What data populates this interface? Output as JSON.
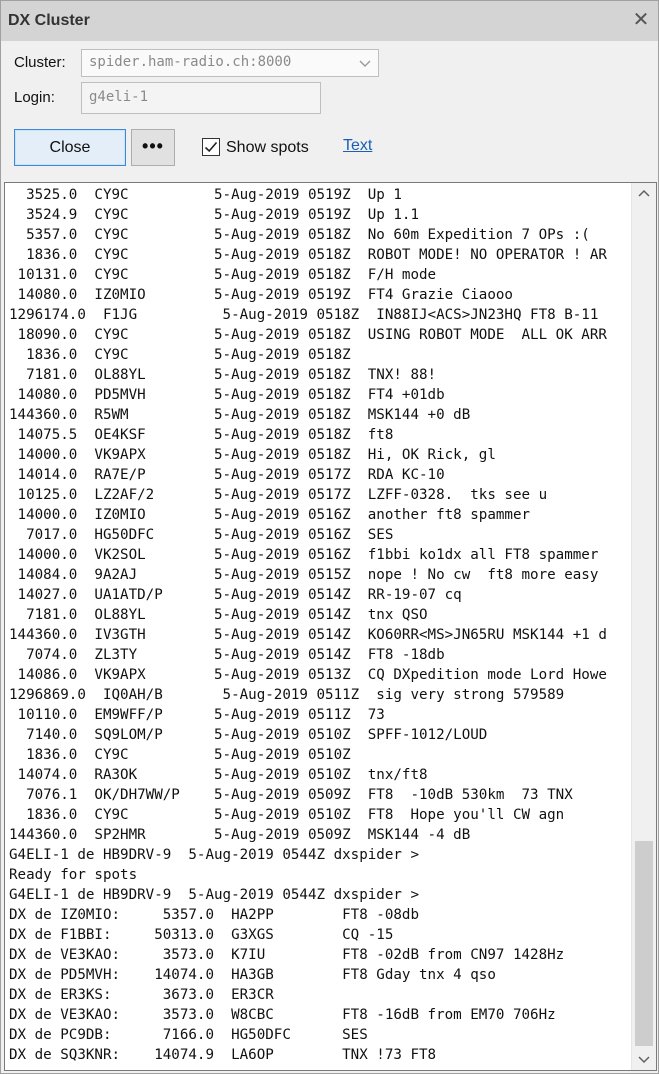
{
  "window": {
    "title": "DX Cluster"
  },
  "form": {
    "cluster_label": "Cluster:",
    "cluster_value": "spider.ham-radio.ch:8000",
    "login_label": "Login:",
    "login_value": "g4eli-1"
  },
  "toolbar": {
    "close_label": "Close",
    "more_label": "•••",
    "show_spots_label": "Show spots",
    "show_spots_checked": true,
    "text_link": "Text"
  },
  "console": {
    "lines": [
      "  3525.0  CY9C          5-Aug-2019 0519Z  Up 1",
      "  3524.9  CY9C          5-Aug-2019 0519Z  Up 1.1",
      "  5357.0  CY9C          5-Aug-2019 0518Z  No 60m Expedition 7 OPs :(",
      "  1836.0  CY9C          5-Aug-2019 0518Z  ROBOT MODE! NO OPERATOR ! AR",
      " 10131.0  CY9C          5-Aug-2019 0518Z  F/H mode",
      " 14080.0  IZ0MIO        5-Aug-2019 0519Z  FT4 Grazie Ciaooo",
      "1296174.0  F1JG          5-Aug-2019 0518Z  IN88IJ<ACS>JN23HQ FT8 B-11",
      " 18090.0  CY9C          5-Aug-2019 0518Z  USING ROBOT MODE  ALL OK ARR",
      "  1836.0  CY9C          5-Aug-2019 0518Z",
      "  7181.0  OL88YL        5-Aug-2019 0518Z  TNX! 88!",
      " 14080.0  PD5MVH        5-Aug-2019 0518Z  FT4 +01db",
      "144360.0  R5WM          5-Aug-2019 0518Z  MSK144 +0 dB",
      " 14075.5  OE4KSF        5-Aug-2019 0518Z  ft8",
      " 14000.0  VK9APX        5-Aug-2019 0518Z  Hi, OK Rick, gl",
      " 14014.0  RA7E/P        5-Aug-2019 0517Z  RDA KC-10",
      " 10125.0  LZ2AF/2       5-Aug-2019 0517Z  LZFF-0328.  tks see u",
      " 14000.0  IZ0MIO        5-Aug-2019 0516Z  another ft8 spammer",
      "  7017.0  HG50DFC       5-Aug-2019 0516Z  SES",
      " 14000.0  VK2SOL        5-Aug-2019 0516Z  f1bbi ko1dx all FT8 spammer",
      " 14084.0  9A2AJ         5-Aug-2019 0515Z  nope ! No cw  ft8 more easy",
      " 14027.0  UA1ATD/P      5-Aug-2019 0514Z  RR-19-07 cq",
      "  7181.0  OL88YL        5-Aug-2019 0514Z  tnx QSO",
      "144360.0  IV3GTH        5-Aug-2019 0514Z  KO60RR<MS>JN65RU MSK144 +1 d",
      "  7074.0  ZL3TY         5-Aug-2019 0514Z  FT8 -18db",
      " 14086.0  VK9APX        5-Aug-2019 0513Z  CQ DXpedition mode Lord Howe",
      "1296869.0  IQ0AH/B       5-Aug-2019 0511Z  sig very strong 579589",
      " 10110.0  EM9WFF/P      5-Aug-2019 0511Z  73",
      "  7140.0  SQ9LOM/P      5-Aug-2019 0510Z  SPFF-1012/LOUD",
      "  1836.0  CY9C          5-Aug-2019 0510Z",
      " 14074.0  RA3OK         5-Aug-2019 0510Z  tnx/ft8",
      "  7076.1  OK/DH7WW/P    5-Aug-2019 0509Z  FT8  -10dB 530km  73 TNX",
      "  1836.0  CY9C          5-Aug-2019 0510Z  FT8  Hope you'll CW agn",
      "144360.0  SP2HMR        5-Aug-2019 0509Z  MSK144 -4 dB",
      "G4ELI-1 de HB9DRV-9  5-Aug-2019 0544Z dxspider >",
      "Ready for spots",
      "G4ELI-1 de HB9DRV-9  5-Aug-2019 0544Z dxspider >",
      "DX de IZ0MIO:     5357.0  HA2PP        FT8 -08db",
      "DX de F1BBI:     50313.0  G3XGS        CQ -15",
      "DX de VE3KAO:     3573.0  K7IU         FT8 -02dB from CN97 1428Hz",
      "DX de PD5MVH:    14074.0  HA3GB        FT8 Gday tnx 4 qso",
      "DX de ER3KS:      3673.0  ER3CR",
      "DX de VE3KAO:     3573.0  W8CBC        FT8 -16dB from EM70 706Hz",
      "DX de PC9DB:      7166.0  HG50DFC      SES",
      "DX de SQ3KNR:    14074.9  LA6OP        TNX !73 FT8"
    ]
  },
  "icons": {
    "close": "close-icon",
    "dropdown": "chevron-down-icon",
    "check": "checkmark-icon",
    "scroll_up": "chevron-up-icon",
    "scroll_down": "chevron-down-icon"
  },
  "colors": {
    "titlebar": "#d4d4d4",
    "link": "#1a5fb4",
    "primary_button_border": "#3b8ad8"
  },
  "scroll": {
    "position_fraction": 1.0
  }
}
